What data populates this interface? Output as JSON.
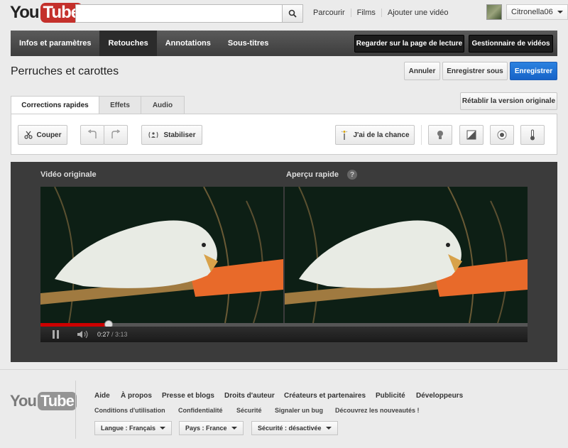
{
  "logo": {
    "you": "You",
    "tube": "Tube"
  },
  "header": {
    "nav": [
      "Parcourir",
      "Films",
      "Ajouter une vidéo"
    ],
    "username": "Citronella06"
  },
  "tabs": [
    "Infos et paramètres",
    "Retouches",
    "Annotations",
    "Sous-titres"
  ],
  "actions": {
    "watch": "Regarder sur la page de lecture",
    "manager": "Gestionnaire de vidéos"
  },
  "page": {
    "title": "Perruches et carottes",
    "cancel": "Annuler",
    "save_as": "Enregistrer sous",
    "save": "Enregistrer",
    "restore": "Rétablir la version originale"
  },
  "edit_tabs": [
    "Corrections rapides",
    "Effets",
    "Audio"
  ],
  "tools": {
    "cut": "Couper",
    "stabilize": "Stabiliser",
    "lucky": "J'ai de la chance"
  },
  "video": {
    "original_label": "Vidéo originale",
    "preview_label": "Aperçu rapide",
    "help": "?",
    "current_time": "0:27",
    "duration": "/ 3:13",
    "progress": 0.14
  },
  "footer": {
    "links1": [
      "Aide",
      "À propos",
      "Presse et blogs",
      "Droits d'auteur",
      "Créateurs et partenaires",
      "Publicité",
      "Développeurs"
    ],
    "links2": [
      "Conditions d'utilisation",
      "Confidentialité",
      "Sécurité",
      "Signaler un bug",
      "Découvrez les nouveautés !"
    ],
    "language": "Langue : Français",
    "country": "Pays : France",
    "safety": "Sécurité : désactivée"
  },
  "colors": {
    "brand": "#c4302b",
    "accent": "#1a6ad2",
    "progress": "#cc0000"
  }
}
